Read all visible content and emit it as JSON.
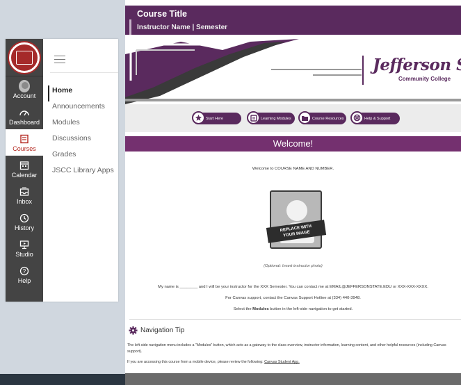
{
  "global_nav": {
    "items": [
      {
        "label": "Account",
        "icon": "account-avatar-icon"
      },
      {
        "label": "Dashboard",
        "icon": "dashboard-icon"
      },
      {
        "label": "Courses",
        "icon": "courses-icon",
        "active": true
      },
      {
        "label": "Calendar",
        "icon": "calendar-icon"
      },
      {
        "label": "Inbox",
        "icon": "inbox-icon"
      },
      {
        "label": "History",
        "icon": "history-icon"
      },
      {
        "label": "Studio",
        "icon": "studio-icon"
      },
      {
        "label": "Help",
        "icon": "help-icon"
      }
    ]
  },
  "course_nav": {
    "items": [
      "Home",
      "Announcements",
      "Modules",
      "Discussions",
      "Grades",
      "JSCC Library Apps"
    ]
  },
  "header": {
    "title": "Course Title",
    "subtitle": "Instructor Name | Semester"
  },
  "banner": {
    "logo_text": "Jefferson State",
    "logo_subtext": "Community College"
  },
  "buttons": [
    "Start Here",
    "Learning Modules",
    "Course Resources",
    "Help & Support"
  ],
  "welcome": {
    "heading": "Welcome!",
    "intro": "Welcome to  COURSE NAME AND NUMBER.",
    "photo_tag_line1": "REPLACE WITH",
    "photo_tag_line2": "YOUR IMAGE",
    "photo_caption": "(Optional: Insert instructor photo)",
    "line1": "My name is ________ and I will be your instructor for the XXX Semester. You can contact me at EMAIL@JEFFERSONSTATE.EDU or XXX-XXX-XXXX.",
    "line2": "For Canvas support, contact the Canvas Support Hotline at (334) 440-3948.",
    "line3_pre": "Select the ",
    "line3_bold": "Modules",
    "line3_post": " button in the left-side navigation to get started."
  },
  "nav_tip": {
    "heading": "Navigation Tip",
    "para1": "The left-side navigation menu includes a \"Modules\" button, which acts as a gateway to the class overview, instructor information, learning content, and other helpful resources (including Canvas support).",
    "para2_pre": "If you are accessing this course from a mobile device, please review the following: ",
    "para2_link": "Canvas Student App."
  },
  "colors": {
    "brand_purple": "#5a2a5e",
    "welcome_purple": "#74306f",
    "canvas_nav_dark": "#444444",
    "canvas_active_red": "#b3261e"
  }
}
